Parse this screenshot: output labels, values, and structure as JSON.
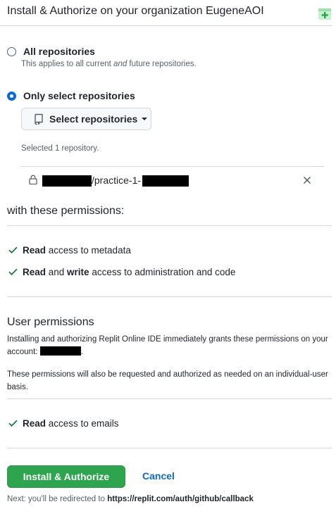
{
  "header": {
    "title": "Install & Authorize on your organization EugeneAOI",
    "app_icon": "app-plus-icon"
  },
  "repo_scope": {
    "all": {
      "label": "All repositories",
      "note_pre": "This applies to all current ",
      "note_em": "and",
      "note_post": " future repositories."
    },
    "selected": {
      "label": "Only select repositories",
      "button_label": "Select repositories",
      "count_text": "Selected 1 repository.",
      "repo_name": "/practice-1-"
    }
  },
  "permissions": {
    "heading": "with these permissions:",
    "items": [
      {
        "strong": "Read",
        "rest": " access to metadata"
      },
      {
        "strong": "Read",
        "mid": " and ",
        "strong2": "write",
        "rest": " access to administration and code"
      }
    ]
  },
  "user_permissions": {
    "title": "User permissions",
    "desc": "Installing and authorizing Replit Online IDE immediately grants these permissions on your account:",
    "desc_end": ".",
    "note": "These permissions will also be requested and authorized as needed on an individual-user basis.",
    "items": [
      {
        "strong": "Read",
        "rest": " access to emails"
      }
    ]
  },
  "actions": {
    "install_label": "Install & Authorize",
    "cancel_label": "Cancel",
    "redirect_prefix": "Next: you'll be redirected to ",
    "redirect_url": "https://replit.com/auth/github/callback"
  },
  "colors": {
    "accent": "#0969da",
    "success": "#2da44e",
    "check": "#1a7f37"
  }
}
